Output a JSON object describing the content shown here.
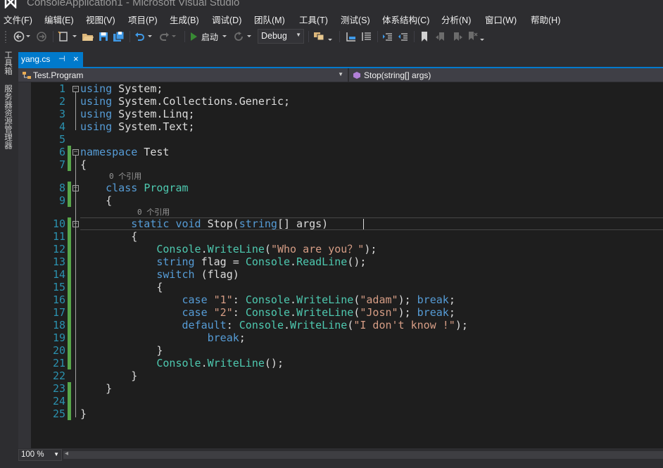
{
  "window": {
    "title": "ConsoleApplication1 - Microsoft Visual Studio"
  },
  "menu": [
    "文件(F)",
    "编辑(E)",
    "视图(V)",
    "项目(P)",
    "生成(B)",
    "调试(D)",
    "团队(M)",
    "工具(T)",
    "测试(S)",
    "体系结构(C)",
    "分析(N)",
    "窗口(W)",
    "帮助(H)"
  ],
  "toolbar": {
    "start_label": "启动",
    "configuration": "Debug",
    "icons": [
      "back-icon",
      "forward-icon",
      "new-project-icon",
      "open-file-icon",
      "save-icon",
      "save-all-icon",
      "undo-icon",
      "redo-icon",
      "start-icon",
      "refresh-icon",
      "find-icon",
      "comment-icon",
      "uncomment-icon",
      "indent-icon",
      "outdent-icon",
      "bookmark-icon",
      "prev-bookmark-icon",
      "next-bookmark-icon",
      "clear-bookmark-icon"
    ]
  },
  "side_panels": [
    "工具箱",
    "服务器资源管理器"
  ],
  "document": {
    "tab_label": "yang.cs",
    "tab_pin": "⊣",
    "tab_close": "×",
    "nav_type": "Test.Program",
    "nav_member": "Stop(string[] args)"
  },
  "editor": {
    "lines": [
      {
        "n": "1",
        "tokens": [
          [
            "kw",
            "using"
          ],
          [
            "pl",
            " System;"
          ]
        ]
      },
      {
        "n": "2",
        "tokens": [
          [
            "kw",
            "using"
          ],
          [
            "pl",
            " System.Collections.Generic;"
          ]
        ]
      },
      {
        "n": "3",
        "tokens": [
          [
            "kw",
            "using"
          ],
          [
            "pl",
            " System.Linq;"
          ]
        ]
      },
      {
        "n": "4",
        "tokens": [
          [
            "kw",
            "using"
          ],
          [
            "pl",
            " System.Text;"
          ]
        ]
      },
      {
        "n": "5",
        "tokens": []
      },
      {
        "n": "6",
        "tokens": [
          [
            "kw",
            "namespace"
          ],
          [
            "pl",
            " Test"
          ]
        ]
      },
      {
        "n": "7",
        "tokens": [
          [
            "pl",
            "{"
          ]
        ]
      },
      {
        "n": "8",
        "tokens": [
          [
            "pl",
            "    "
          ],
          [
            "kw",
            "class"
          ],
          [
            "pl",
            " "
          ],
          [
            "ty",
            "Program"
          ]
        ]
      },
      {
        "n": "9",
        "tokens": [
          [
            "pl",
            "    {"
          ]
        ]
      },
      {
        "n": "10",
        "tokens": [
          [
            "pl",
            "        "
          ],
          [
            "kw",
            "static"
          ],
          [
            "pl",
            " "
          ],
          [
            "kw",
            "void"
          ],
          [
            "pl",
            " Stop("
          ],
          [
            "kw",
            "string"
          ],
          [
            "pl",
            "[] args)"
          ]
        ]
      },
      {
        "n": "11",
        "tokens": [
          [
            "pl",
            "        {"
          ]
        ]
      },
      {
        "n": "12",
        "tokens": [
          [
            "pl",
            "            "
          ],
          [
            "ty",
            "Console"
          ],
          [
            "pl",
            "."
          ],
          [
            "ty",
            "WriteLine"
          ],
          [
            "pl",
            "("
          ],
          [
            "st",
            "\"Who are you？\""
          ],
          [
            "pl",
            ");"
          ]
        ]
      },
      {
        "n": "13",
        "tokens": [
          [
            "pl",
            "            "
          ],
          [
            "kw",
            "string"
          ],
          [
            "pl",
            " flag = "
          ],
          [
            "ty",
            "Console"
          ],
          [
            "pl",
            "."
          ],
          [
            "ty",
            "ReadLine"
          ],
          [
            "pl",
            "();"
          ]
        ]
      },
      {
        "n": "14",
        "tokens": [
          [
            "pl",
            "            "
          ],
          [
            "kw",
            "switch"
          ],
          [
            "pl",
            " (flag)"
          ]
        ]
      },
      {
        "n": "15",
        "tokens": [
          [
            "pl",
            "            {"
          ]
        ]
      },
      {
        "n": "16",
        "tokens": [
          [
            "pl",
            "                "
          ],
          [
            "kw",
            "case"
          ],
          [
            "pl",
            " "
          ],
          [
            "st",
            "\"1\""
          ],
          [
            "pl",
            ": "
          ],
          [
            "ty",
            "Console"
          ],
          [
            "pl",
            "."
          ],
          [
            "ty",
            "WriteLine"
          ],
          [
            "pl",
            "("
          ],
          [
            "st",
            "\"adam\""
          ],
          [
            "pl",
            "); "
          ],
          [
            "kw",
            "break"
          ],
          [
            "pl",
            ";"
          ]
        ]
      },
      {
        "n": "17",
        "tokens": [
          [
            "pl",
            "                "
          ],
          [
            "kw",
            "case"
          ],
          [
            "pl",
            " "
          ],
          [
            "st",
            "\"2\""
          ],
          [
            "pl",
            ": "
          ],
          [
            "ty",
            "Console"
          ],
          [
            "pl",
            "."
          ],
          [
            "ty",
            "WriteLine"
          ],
          [
            "pl",
            "("
          ],
          [
            "st",
            "\"Josn\""
          ],
          [
            "pl",
            "); "
          ],
          [
            "kw",
            "break"
          ],
          [
            "pl",
            ";"
          ]
        ]
      },
      {
        "n": "18",
        "tokens": [
          [
            "pl",
            "                "
          ],
          [
            "kw",
            "default"
          ],
          [
            "pl",
            ": "
          ],
          [
            "ty",
            "Console"
          ],
          [
            "pl",
            "."
          ],
          [
            "ty",
            "WriteLine"
          ],
          [
            "pl",
            "("
          ],
          [
            "st",
            "\"I don't know !\""
          ],
          [
            "pl",
            ");"
          ]
        ]
      },
      {
        "n": "19",
        "tokens": [
          [
            "pl",
            "                    "
          ],
          [
            "kw",
            "break"
          ],
          [
            "pl",
            ";"
          ]
        ]
      },
      {
        "n": "20",
        "tokens": [
          [
            "pl",
            "            }"
          ]
        ]
      },
      {
        "n": "21",
        "tokens": [
          [
            "pl",
            "            "
          ],
          [
            "ty",
            "Console"
          ],
          [
            "pl",
            "."
          ],
          [
            "ty",
            "WriteLine"
          ],
          [
            "pl",
            "();"
          ]
        ]
      },
      {
        "n": "22",
        "tokens": [
          [
            "pl",
            "        }"
          ]
        ]
      },
      {
        "n": "23",
        "tokens": [
          [
            "pl",
            "    }"
          ]
        ]
      },
      {
        "n": "24",
        "tokens": []
      },
      {
        "n": "25",
        "tokens": [
          [
            "pl",
            "}"
          ]
        ]
      }
    ],
    "lens_class": "0 个引用",
    "lens_method": "0 个引用"
  },
  "statusbar": {
    "zoom": "100 %"
  },
  "colors": {
    "accent": "#007acc",
    "keyword": "#569cd6",
    "type": "#4ec9b0",
    "string": "#d69d85",
    "line_number": "#2b91af",
    "change_bar": "#57a64a"
  }
}
